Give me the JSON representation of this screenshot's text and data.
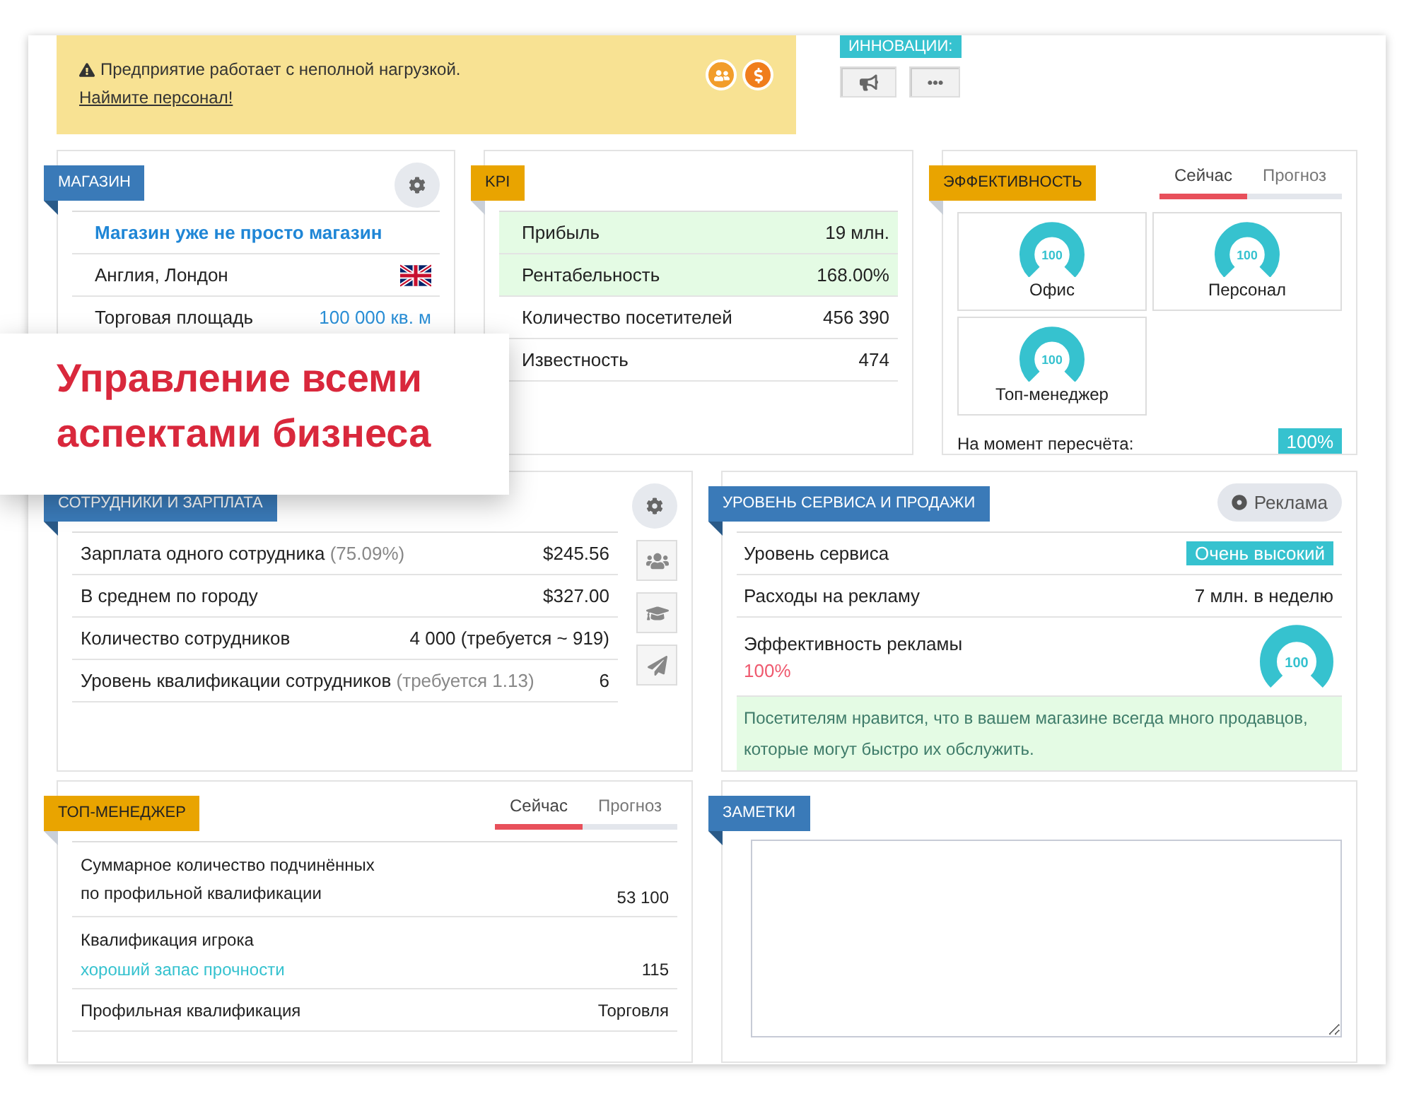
{
  "alert": {
    "message": "Предприятие работает с неполной нагрузкой.",
    "link": "Наймите персонал!"
  },
  "innovations": {
    "title": "ИННОВАЦИИ:"
  },
  "shop": {
    "title": "МАГАЗИН",
    "name": "Магазин уже не просто магазин",
    "rows": [
      {
        "kind": "flag",
        "label": "Англия, Лондон"
      },
      {
        "kind": "link",
        "label": "Торговая площадь",
        "value": "100 000 кв. м"
      }
    ]
  },
  "kpi": {
    "title": "KPI",
    "rows": [
      {
        "label": "Прибыль",
        "value": "19 млн.",
        "highlighted": true
      },
      {
        "label": "Рентабельность",
        "value": "168.00%",
        "highlighted": true
      },
      {
        "label": "Количество посетителей",
        "value": "456 390",
        "highlighted": false
      },
      {
        "label": "Известность",
        "value": "474",
        "highlighted": false
      }
    ]
  },
  "efficiency": {
    "title": "ЭФФЕКТИВНОСТЬ",
    "tabs": [
      {
        "label": "Сейчас",
        "selected": true
      },
      {
        "label": "Прогноз",
        "selected": false
      }
    ],
    "gauges": [
      {
        "label": "Офис",
        "reading": "100"
      },
      {
        "label": "Персонал",
        "reading": "100"
      },
      {
        "label": "Топ-менеджер",
        "reading": "100"
      }
    ],
    "recalc": {
      "label": "На момент пересчёта:",
      "value": "100%"
    }
  },
  "staff": {
    "title": "СОТРУДНИКИ И ЗАРПЛАТА",
    "rows": [
      {
        "label": "Зарплата одного сотрудника",
        "note": "(75.09%)",
        "value": "$245.56"
      },
      {
        "label": "В среднем по городу",
        "value": "$327.00"
      },
      {
        "label": "Количество сотрудников",
        "value": "4 000 (требуется ~ 919)"
      },
      {
        "label": "Уровень квалификации сотрудников",
        "note": "(требуется 1.13)",
        "value": "6"
      }
    ]
  },
  "service": {
    "title": "УРОВЕНЬ СЕРВИСА И ПРОДАЖИ",
    "button": "Реклама",
    "rows": [
      {
        "kind": "badge",
        "label": "Уровень сервиса",
        "value": "Очень высокий"
      },
      {
        "kind": "text",
        "label": "Расходы на рекламу",
        "value": "7 млн. в неделю"
      },
      {
        "kind": "gauge",
        "label": "Эффективность рекламы",
        "sub": "100%",
        "reading": "100"
      }
    ],
    "message": "Посетителям нравится, что в вашем магазине всегда много продавцов, которые могут быстро их обслужить."
  },
  "top_manager": {
    "title": "ТОП-МЕНЕДЖЕР",
    "tabs": [
      {
        "label": "Сейчас",
        "selected": true
      },
      {
        "label": "Прогноз",
        "selected": false
      }
    ],
    "rows": [
      {
        "label": "Суммарное количество подчинённых по профильной квалификации",
        "value": "53 100"
      },
      {
        "label": "Квалификация игрока",
        "sub": "хороший запас прочности",
        "value": "115"
      },
      {
        "label": "Профильная квалификация",
        "value": "Торговля"
      }
    ]
  },
  "notes": {
    "title": "ЗАМЕТКИ"
  },
  "promo": {
    "headline": "Управление всеми аспектами бизнеса"
  }
}
